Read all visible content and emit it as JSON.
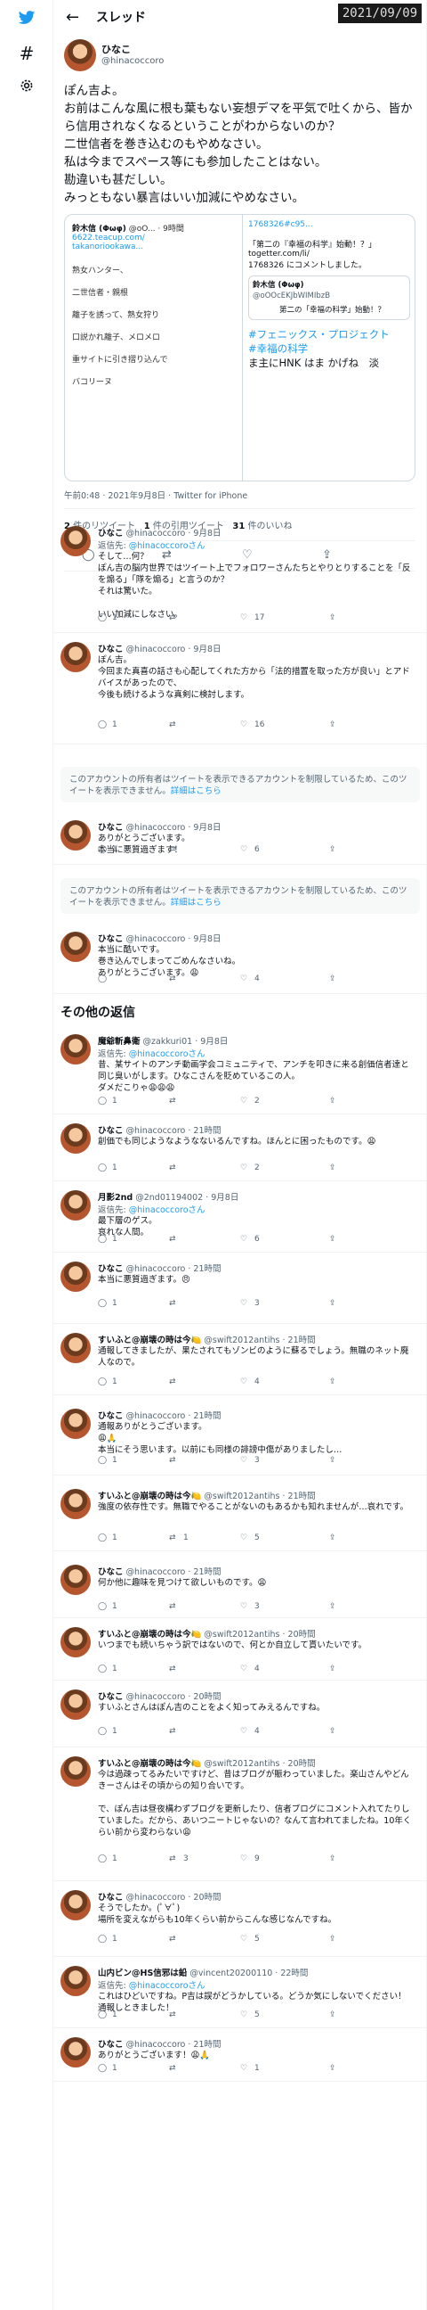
{
  "header": {
    "title": "スレッド",
    "date_badge": "2021/09/09"
  },
  "main": {
    "name": "ひなこ",
    "handle": "@hinacoccoro",
    "body": "ぽん吉よ。\nお前はこんな風に根も葉もない妄想デマを平気で吐くから、皆から信用されなくなるということがわからないのか？\n二世信者を巻き込むのもやめなさい。\n私は今までスペース等にも参加したことはない。\n勘違いも甚だしい。\nみっともない暴言はいい加減にやめなさい。",
    "media": {
      "q_name": "鈴木信 (Φωφ)",
      "q_handle": "@oO...",
      "q_time": "9時間",
      "q_link": "6622.teacup.com/",
      "q_link2": "takanoriookawa...",
      "sidebar": [
        "熟女ハンター、",
        "二世信者・親根",
        "離子を誘って、熟女狩り",
        "口説かれ離子、メロメロ",
        "重サイトに引き摺り込んで",
        "バコリーヌ"
      ],
      "r_link": "1768326#c95...",
      "r_q1": "「第二の『幸福の科学』始動！？」togetter.com/li/",
      "r_q2": "1768326 にコメントしました。",
      "r_card_name": "鈴木信 (Φωφ)",
      "r_card_handle": "@oOOcEKJbWIMIbzB",
      "r_card_title": "第二の「幸福の科学」始動！？",
      "r_big1": "#フェニックス・プロジェクト",
      "r_big2": "#幸福の科学",
      "r_big3": "ま主にHNK はま かげね　淡"
    },
    "meta": "午前0:48 · 2021年9月8日 · Twitter for iPhone",
    "stats": {
      "rt": "2",
      "rt_label": "件のリツイート",
      "q": "1",
      "q_label": "件の引用ツイート",
      "likes": "31",
      "likes_label": "件のいいね"
    }
  },
  "replies": [
    {
      "name": "ひなこ",
      "handle": "@hinacoccoro · 9月8日",
      "to": "@hinacoccoroさん",
      "text": "そして…何？\nぽん吉の脳内世界ではツイート上でフォロワーさんたちとやりとりすることを「反を煽る」「隊を煽る」と言うのか？\nそれは驚いた。\n\nいい加減にしなさい。",
      "reply": "1",
      "rt": "",
      "like": "17"
    },
    {
      "name": "ひなこ",
      "handle": "@hinacoccoro · 9月8日",
      "to": "",
      "text": "ぽん吉。\n今回また真喜の話さも心配してくれた方から「法的措置を取った方が良い」とアドバイスがあったので、\n今後も続けるような真剣に検討します。",
      "reply": "1",
      "rt": "",
      "like": "16"
    },
    {
      "name": "ひなこ",
      "handle": "@hinacoccoro · 9月8日",
      "to": "",
      "text": "ありがとうございます。\n本当に悪質過ぎます！",
      "reply": "1",
      "rt": "",
      "like": "6"
    },
    {
      "name": "ひなこ",
      "handle": "@hinacoccoro · 9月8日",
      "to": "",
      "text": "本当に酷いです。\n巻き込んでしまってごめんなさいね。\nありがとうございます。😩",
      "reply": "",
      "rt": "",
      "like": "4"
    },
    {
      "name": "魔爺斬鼻衛",
      "handle": "@zakkuri01 · 9月8日",
      "to": "@hinacoccoroさん",
      "text": "昔、某サイトのアンチ動画学会コミュニティで、アンチを叩きに来る創価信者達と同じ臭いがします。ひなこさんを貶めているこの人。\nダメだこりゃ😩😩😩",
      "reply": "1",
      "rt": "",
      "like": "2"
    },
    {
      "name": "ひなこ",
      "handle": "@hinacoccoro · 21時間",
      "to": "",
      "text": "創価でも同じようなようなないるんですね。ほんとに困ったものです。😩",
      "reply": "1",
      "rt": "",
      "like": "2"
    },
    {
      "name": "月影2nd",
      "handle": "@2nd01194002 · 9月8日",
      "to": "@hinacoccoroさん",
      "text": "最下層のゲス。\n哀れな人間。",
      "reply": "1",
      "rt": "",
      "like": "6"
    },
    {
      "name": "ひなこ",
      "handle": "@hinacoccoro · 21時間",
      "to": "",
      "text": "本当に悪質過ぎます。😠",
      "reply": "1",
      "rt": "",
      "like": "3"
    },
    {
      "name": "すいふと@崩壊の時は今🍋",
      "handle": "@swift2012antihs · 21時間",
      "to": "",
      "text": "通報してきましたが、果たされてもゾンビのように蘇るでしょう。無職のネット廃人なので。",
      "reply": "1",
      "rt": "",
      "like": "4"
    },
    {
      "name": "ひなこ",
      "handle": "@hinacoccoro · 21時間",
      "to": "",
      "text": "通報ありがとうございます。\n😩🙏\n本当にそう思います。以前にも同様の誹謗中傷がありましたし…",
      "reply": "1",
      "rt": "",
      "like": "3"
    },
    {
      "name": "すいふと@崩壊の時は今🍋",
      "handle": "@swift2012antihs · 21時間",
      "to": "",
      "text": "強度の依存性です。無職でやることがないのもあるかも知れませんが…哀れです。",
      "reply": "1",
      "rt": "1",
      "like": "5"
    },
    {
      "name": "ひなこ",
      "handle": "@hinacoccoro · 21時間",
      "to": "",
      "text": "何か他に趣味を見つけて欲しいものです。😩",
      "reply": "1",
      "rt": "",
      "like": "3"
    },
    {
      "name": "すいふと@崩壊の時は今🍋",
      "handle": "@swift2012antihs · 20時間",
      "to": "",
      "text": "いつまでも続いちゃう訳ではないので、何とか自立して貰いたいです。",
      "reply": "1",
      "rt": "",
      "like": "4"
    },
    {
      "name": "ひなこ",
      "handle": "@hinacoccoro · 20時間",
      "to": "",
      "text": "すいふとさんはぽん吉のことをよく知ってみえるんですね。",
      "reply": "1",
      "rt": "",
      "like": "4"
    },
    {
      "name": "すいふと@崩壊の時は今🍋",
      "handle": "@swift2012antihs · 20時間",
      "to": "",
      "text": "今は過疎ってるみたいですけど、昔はブログが賑わっていました。楽山さんやどんきーさんはその頃からの知り合いです。\n\nで、ぽん吉は昼夜構わずブログを更新したり、信者ブログにコメント入れてたりしていました。だから、あいつニートじゃないの？なんて言われてましたね。10年くらい前から変わらない😩",
      "reply": "1",
      "rt": "3",
      "like": "9"
    },
    {
      "name": "ひなこ",
      "handle": "@hinacoccoro · 20時間",
      "to": "",
      "text": "そうでしたか。(ﾟ∀ﾟ)\n場所を変えながらも10年くらい前からこんな感じなんですね。",
      "reply": "1",
      "rt": "",
      "like": "5"
    },
    {
      "name": "山内ビン@HS信邪は鉛",
      "handle": "@vincent20200110 · 22時間",
      "to": "@hinacoccoroさん",
      "text": "これはひどいですね。P吉は誤がどうかしている。どうか気にしないでください！通報しときました！",
      "reply": "1",
      "rt": "",
      "like": "5"
    },
    {
      "name": "ひなこ",
      "handle": "@hinacoccoro · 21時間",
      "to": "",
      "text": "ありがとうございます！😩🙏",
      "reply": "1",
      "rt": "",
      "like": "1"
    }
  ],
  "notice": {
    "text": "このアカウントの所有者はツイートを表示できるアカウントを制限しているため、このツイートを表示できません。",
    "link": "詳細はこちら"
  },
  "section_title": "その他の返信",
  "reply_to_prefix": "返信先:"
}
